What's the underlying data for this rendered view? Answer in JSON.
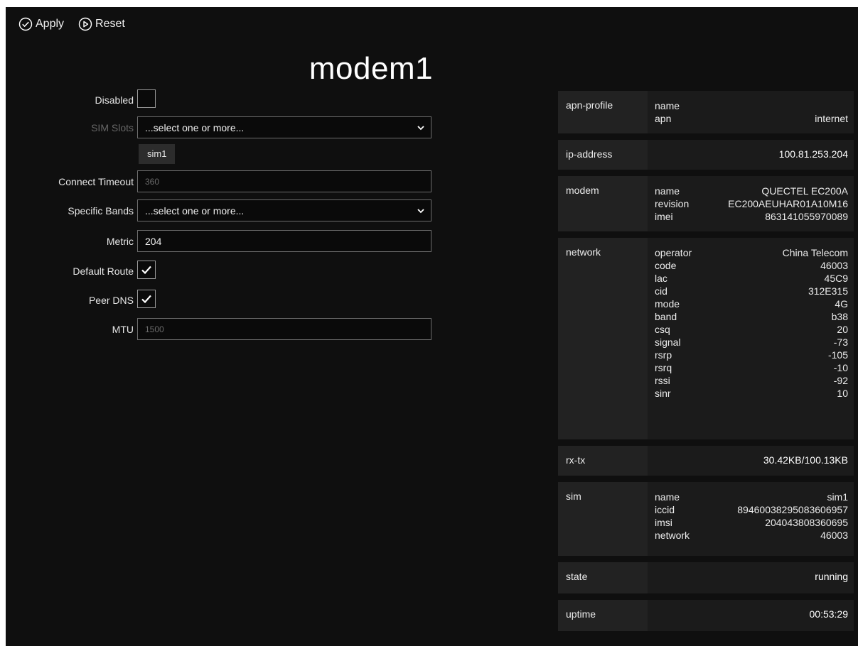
{
  "toolbar": {
    "apply_label": "Apply",
    "reset_label": "Reset"
  },
  "page": {
    "title": "modem1"
  },
  "form": {
    "disabled_label": "Disabled",
    "sim_slots_label": "SIM Slots",
    "sim_slots_placeholder": "...select one or more...",
    "sim_slots_chip": "sim1",
    "connect_timeout_label": "Connect Timeout",
    "connect_timeout_placeholder": "360",
    "specific_bands_label": "Specific Bands",
    "specific_bands_placeholder": "...select one or more...",
    "metric_label": "Metric",
    "metric_value": "204",
    "default_route_label": "Default Route",
    "peer_dns_label": "Peer DNS",
    "mtu_label": "MTU",
    "mtu_placeholder": "1500",
    "disabled_checked": false,
    "default_route_checked": true,
    "peer_dns_checked": true
  },
  "status": {
    "apn_profile": {
      "key": "apn-profile",
      "name_k": "name",
      "name_v": "",
      "apn_k": "apn",
      "apn_v": "internet"
    },
    "ip_address": {
      "key": "ip-address",
      "value": "100.81.253.204"
    },
    "modem": {
      "key": "modem",
      "name_k": "name",
      "name_v": "QUECTEL EC200A",
      "revision_k": "revision",
      "revision_v": "EC200AEUHAR01A10M16",
      "imei_k": "imei",
      "imei_v": "863141055970089"
    },
    "network": {
      "key": "network",
      "items": [
        {
          "k": "operator",
          "v": "China Telecom"
        },
        {
          "k": "code",
          "v": "46003"
        },
        {
          "k": "lac",
          "v": "45C9"
        },
        {
          "k": "cid",
          "v": "312E315"
        },
        {
          "k": "mode",
          "v": "4G"
        },
        {
          "k": "band",
          "v": "b38"
        },
        {
          "k": "csq",
          "v": "20"
        },
        {
          "k": "signal",
          "v": "-73"
        },
        {
          "k": "rsrp",
          "v": "-105"
        },
        {
          "k": "rsrq",
          "v": "-10"
        },
        {
          "k": "rssi",
          "v": "-92"
        },
        {
          "k": "sinr",
          "v": "10"
        }
      ]
    },
    "rx_tx": {
      "key": "rx-tx",
      "value": "30.42KB/100.13KB"
    },
    "sim": {
      "key": "sim",
      "name_k": "name",
      "name_v": "sim1",
      "iccid_k": "iccid",
      "iccid_v": "89460038295083606957",
      "imsi_k": "imsi",
      "imsi_v": "204043808360695",
      "network_k": "network",
      "network_v": "46003"
    },
    "state": {
      "key": "state",
      "value": "running"
    },
    "uptime": {
      "key": "uptime",
      "value": "00:53:29"
    }
  },
  "colors": {
    "background": "#0f0f0f",
    "row_key_bg": "#222222",
    "row_value_bg": "#1b1b1b",
    "input_border": "#6d6d6d"
  },
  "icons": {
    "apply": "check-circle-icon",
    "reset": "play-circle-icon",
    "dropdown": "chevron-down-icon",
    "checkbox": "checkmark-icon"
  }
}
